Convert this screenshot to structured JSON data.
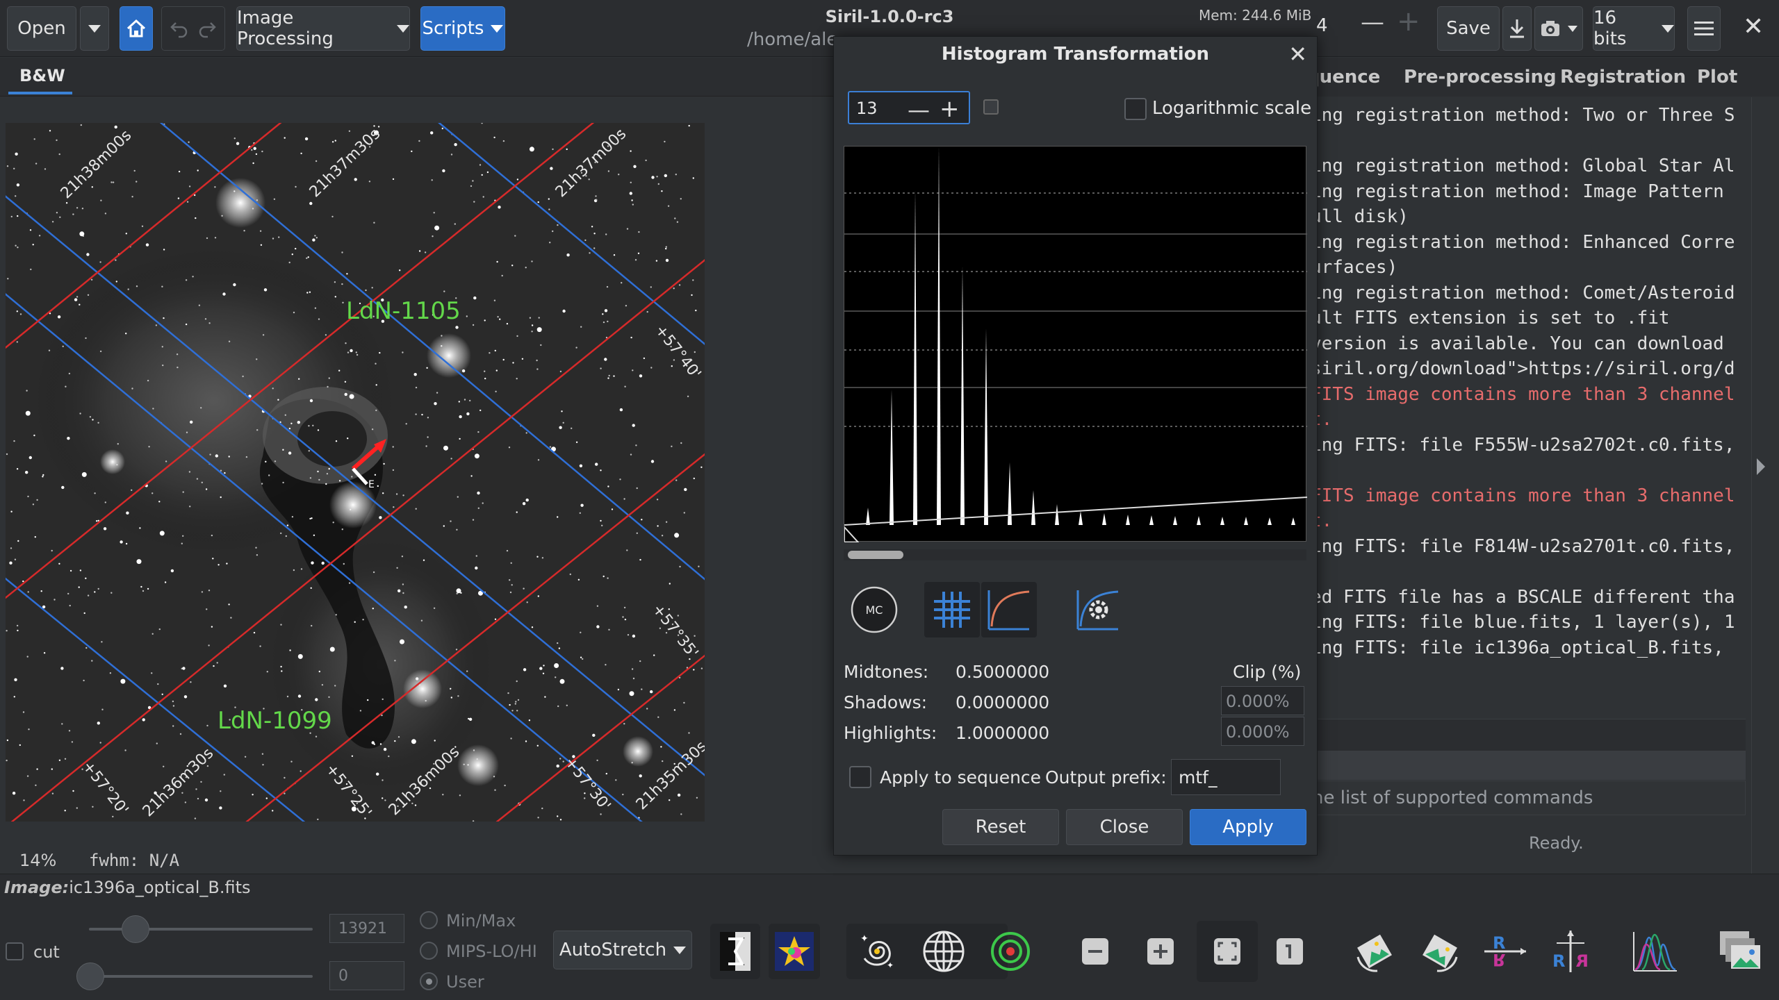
{
  "header": {
    "open_label": "Open",
    "image_processing_label": "Image Processing",
    "scripts_label": "Scripts",
    "title": "Siril-1.0.0-rc3",
    "path": "/home/ale",
    "memory": "Mem: 244.6 MiB",
    "preview_number": "4",
    "save_label": "Save",
    "bit_depth": "16 bits"
  },
  "left_tabs": {
    "bw": "B&W"
  },
  "image": {
    "labels": [
      "LdN-1105",
      "LdN-1099"
    ],
    "grid_ra": [
      "21h38m00s",
      "21h37m30s",
      "21h37m00s",
      "21h36m30s",
      "21h36m00s",
      "21h35m30s"
    ],
    "grid_dec": [
      "+57°40'",
      "+57°35'",
      "+57°30'",
      "+57°25'",
      "+57°20'"
    ],
    "compass_e": "E",
    "colors": {
      "ra_line": "#2f6fd6",
      "dec_line": "#d62a2a",
      "label": "#63d84a"
    }
  },
  "status": {
    "zoom": "14%",
    "fwhm": "fwhm:  N/A"
  },
  "bottom": {
    "image_prefix": "Image:",
    "image_name": "ic1396a_optical_B.fits",
    "cut_label": "cut",
    "hi_value": "13921",
    "lo_value": "0",
    "radio_minmax": "Min/Max",
    "radio_mips": "MIPS-LO/HI",
    "radio_user": "User",
    "stretch_mode": "AutoStretch"
  },
  "right_tabs": [
    "quence",
    "Pre-processing",
    "Registration",
    "Plot"
  ],
  "console": {
    "lines": [
      {
        "text": "ing registration method: Two or Three S",
        "err": false
      },
      {
        "text": "",
        "err": false
      },
      {
        "text": "ing registration method: Global Star Al",
        "err": false
      },
      {
        "text": "ing registration method: Image Pattern",
        "err": false
      },
      {
        "text": "ull disk)",
        "err": false
      },
      {
        "text": "ing registration method: Enhanced Corre",
        "err": false
      },
      {
        "text": "urfaces)",
        "err": false
      },
      {
        "text": "ing registration method: Comet/Asteroid",
        "err": false
      },
      {
        "text": "ult FITS extension is set to .fit",
        "err": false
      },
      {
        "text": "version is available. You can download",
        "err": false
      },
      {
        "text": "siril.org/download\">https://siril.org/d",
        "err": false
      },
      {
        "text": "FITS image contains more than 3 channel",
        "err": true
      },
      {
        "text": "t.",
        "err": true
      },
      {
        "text": "ing FITS: file F555W-u2sa2702t.c0.fits,",
        "err": false
      },
      {
        "text": "",
        "err": false
      },
      {
        "text": "FITS image contains more than 3 channel",
        "err": true
      },
      {
        "text": "t.",
        "err": true
      },
      {
        "text": "ing FITS: file F814W-u2sa2701t.c0.fits,",
        "err": false
      },
      {
        "text": "",
        "err": false
      },
      {
        "text": "ed FITS file has a BSCALE different tha",
        "err": false
      },
      {
        "text": "ing FITS: file blue.fits, 1 layer(s), 1",
        "err": false
      },
      {
        "text": "ing FITS: file ic1396a_optical_B.fits,",
        "err": false
      }
    ],
    "command_hint": "he list of supported commands",
    "ready": "Ready."
  },
  "dialog": {
    "title": "Histogram Transformation",
    "zoom_value": "13",
    "log_scale_label": "Logarithmic scale",
    "mc_label": "MC",
    "midtones_label": "Midtones:",
    "midtones_value": "0.5000000",
    "shadows_label": "Shadows:",
    "shadows_value": "0.0000000",
    "highlights_label": "Highlights:",
    "highlights_value": "1.0000000",
    "clip_label": "Clip (%)",
    "clip_shadows": "0.000%",
    "clip_highlights": "0.000%",
    "apply_seq_label": "Apply to sequence",
    "prefix_label": "Output prefix:",
    "prefix_value": "mtf_",
    "reset_label": "Reset",
    "close_label": "Close",
    "apply_label": "Apply"
  }
}
